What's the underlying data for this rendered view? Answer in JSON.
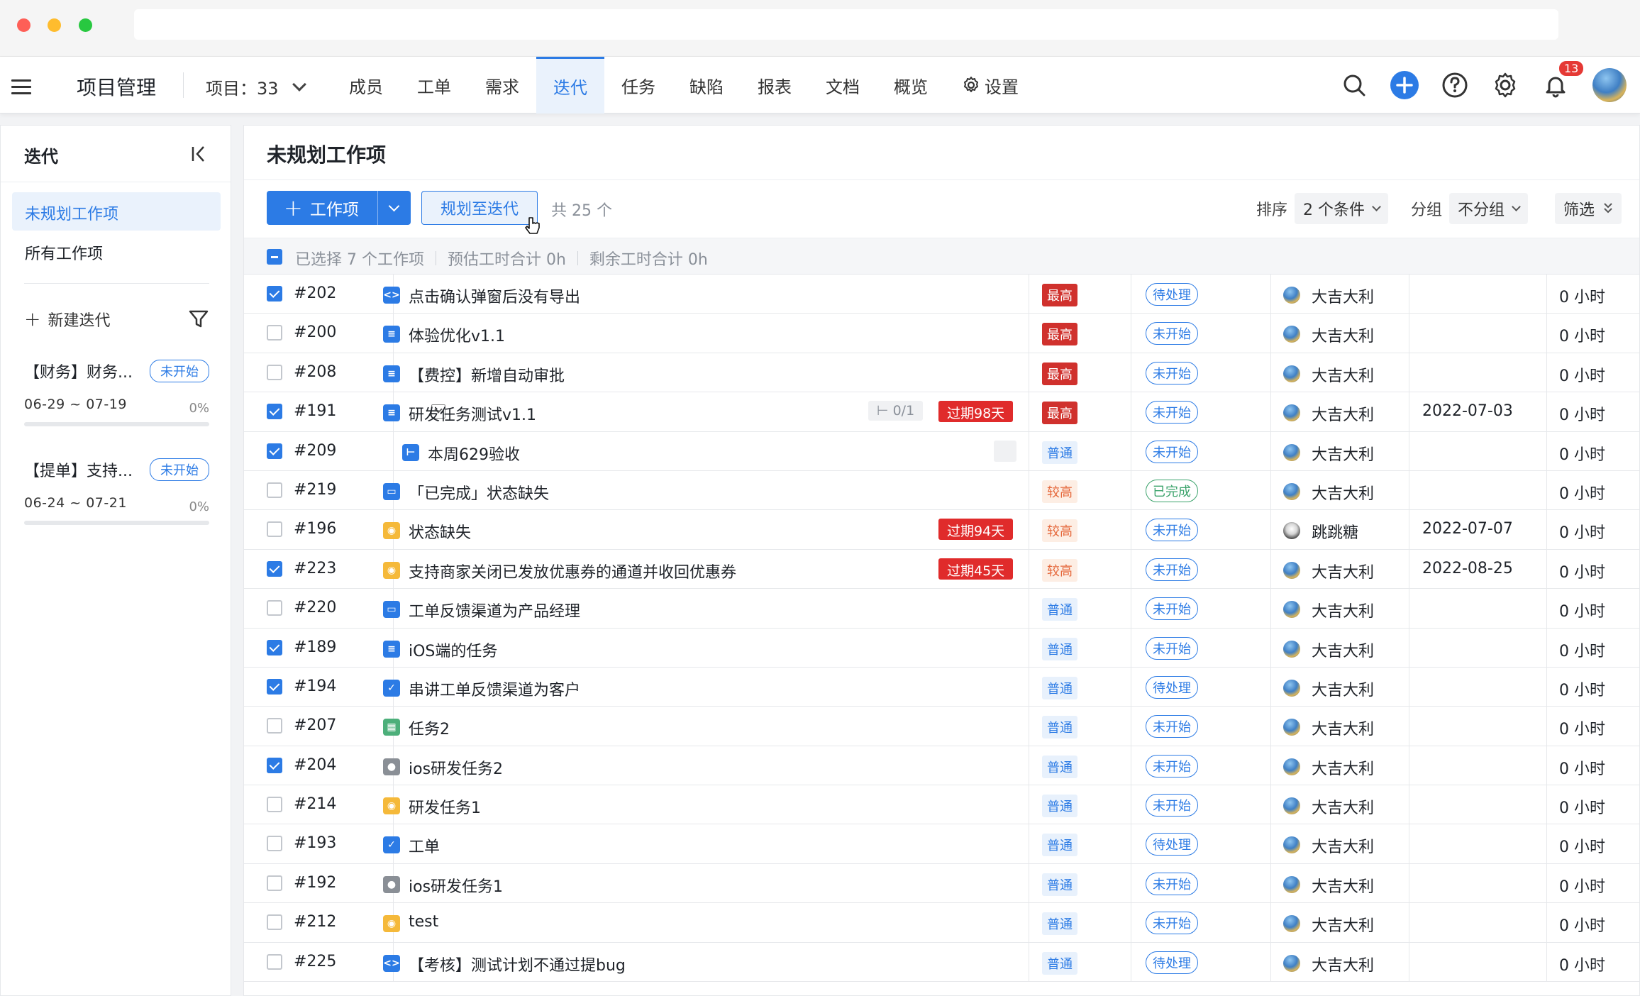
{
  "nav": {
    "app_title": "项目管理",
    "project_label": "项目：33",
    "tabs": [
      {
        "label": "成员",
        "active": false
      },
      {
        "label": "工单",
        "active": false
      },
      {
        "label": "需求",
        "active": false
      },
      {
        "label": "迭代",
        "active": true
      },
      {
        "label": "任务",
        "active": false
      },
      {
        "label": "缺陷",
        "active": false
      },
      {
        "label": "报表",
        "active": false
      },
      {
        "label": "文档",
        "active": false
      },
      {
        "label": "概览",
        "active": false
      },
      {
        "label": "设置",
        "active": false
      }
    ],
    "notification_count": "13",
    "accent": "#2c7be5"
  },
  "sidebar": {
    "title": "迭代",
    "items": [
      {
        "label": "未规划工作项",
        "active": true
      },
      {
        "label": "所有工作项",
        "active": false
      }
    ],
    "new_iteration": "新建迭代",
    "iterations": [
      {
        "name": "【财务】财务...",
        "status": "未开始",
        "dates": "06-29 ~ 07-19",
        "progress": "0%"
      },
      {
        "name": "【提单】支持...",
        "status": "未开始",
        "dates": "06-24 ~ 07-21",
        "progress": "0%"
      }
    ]
  },
  "main": {
    "title": "未规划工作项",
    "add_button": "工作项",
    "plan_button": "规划至迭代",
    "total": "共 25 个",
    "sort_label": "排序",
    "sort_value": "2 个条件",
    "group_label": "分组",
    "group_value": "不分组",
    "filter_label": "筛选",
    "selection": {
      "selected": "已选择 7 个工作项",
      "estimate": "预估工时合计 0h",
      "remaining": "剩余工时合计 0h"
    },
    "rows": [
      {
        "checked": true,
        "id": "#202",
        "icon": "code",
        "title": "点击确认弹窗后没有导出",
        "indent": 0,
        "priority": "最高",
        "ptype": "highest",
        "status": "待处理",
        "assignee": "大吉大利",
        "due": "",
        "hours": "0 小时"
      },
      {
        "checked": false,
        "id": "#200",
        "icon": "doc",
        "title": "体验优化v1.1",
        "indent": 0,
        "priority": "最高",
        "ptype": "highest",
        "status": "未开始",
        "assignee": "大吉大利",
        "due": "",
        "hours": "0 小时"
      },
      {
        "checked": false,
        "id": "#208",
        "icon": "doc",
        "title": "【费控】新增自动审批",
        "indent": 0,
        "priority": "最高",
        "ptype": "highest",
        "status": "未开始",
        "assignee": "大吉大利",
        "due": "",
        "hours": "0 小时"
      },
      {
        "checked": true,
        "id": "#191",
        "icon": "doc",
        "title": "研发任务测试v1.1",
        "indent": 0,
        "toggle": true,
        "subtasks": "0/1",
        "overdue": "过期98天",
        "priority": "最高",
        "ptype": "highest",
        "status": "未开始",
        "assignee": "大吉大利",
        "due": "2022-07-03",
        "hours": "0 小时"
      },
      {
        "checked": true,
        "id": "#209",
        "icon": "sub",
        "title": "本周629验收",
        "indent": 1,
        "subicon": true,
        "priority": "普通",
        "ptype": "normal",
        "status": "未开始",
        "assignee": "大吉大利",
        "due": "",
        "hours": "0 小时"
      },
      {
        "checked": false,
        "id": "#219",
        "icon": "monitor",
        "title": "「已完成」状态缺失",
        "indent": 0,
        "priority": "较高",
        "ptype": "high",
        "status": "已完成",
        "done": true,
        "assignee": "大吉大利",
        "due": "",
        "hours": "0 小时"
      },
      {
        "checked": false,
        "id": "#196",
        "icon": "bulb",
        "title": "状态缺失",
        "indent": 0,
        "overdue": "过期94天",
        "priority": "较高",
        "ptype": "high",
        "status": "未开始",
        "assignee": "跳跳糖",
        "altavatar": true,
        "due": "2022-07-07",
        "hours": "0 小时"
      },
      {
        "checked": true,
        "id": "#223",
        "icon": "bulb",
        "title": "支持商家关闭已发放优惠券的通道并收回优惠券",
        "indent": 0,
        "overdue": "过期45天",
        "priority": "较高",
        "ptype": "high",
        "status": "未开始",
        "assignee": "大吉大利",
        "due": "2022-08-25",
        "hours": "0 小时"
      },
      {
        "checked": false,
        "id": "#220",
        "icon": "monitor",
        "title": "工单反馈渠道为产品经理",
        "indent": 0,
        "priority": "普通",
        "ptype": "normal",
        "status": "未开始",
        "assignee": "大吉大利",
        "due": "",
        "hours": "0 小时"
      },
      {
        "checked": true,
        "id": "#189",
        "icon": "doc",
        "title": "iOS端的任务",
        "indent": 0,
        "priority": "普通",
        "ptype": "normal",
        "status": "未开始",
        "assignee": "大吉大利",
        "due": "",
        "hours": "0 小时"
      },
      {
        "checked": true,
        "id": "#194",
        "icon": "check",
        "title": "串讲工单反馈渠道为客户",
        "indent": 0,
        "priority": "普通",
        "ptype": "normal",
        "status": "待处理",
        "assignee": "大吉大利",
        "due": "",
        "hours": "0 小时"
      },
      {
        "checked": false,
        "id": "#207",
        "icon": "android",
        "title": "任务2",
        "indent": 0,
        "priority": "普通",
        "ptype": "normal",
        "status": "未开始",
        "assignee": "大吉大利",
        "due": "",
        "hours": "0 小时"
      },
      {
        "checked": true,
        "id": "#204",
        "icon": "apple",
        "title": "ios研发任务2",
        "indent": 0,
        "priority": "普通",
        "ptype": "normal",
        "status": "未开始",
        "assignee": "大吉大利",
        "due": "",
        "hours": "0 小时"
      },
      {
        "checked": false,
        "id": "#214",
        "icon": "bulb",
        "title": "研发任务1",
        "indent": 0,
        "priority": "普通",
        "ptype": "normal",
        "status": "未开始",
        "assignee": "大吉大利",
        "due": "",
        "hours": "0 小时"
      },
      {
        "checked": false,
        "id": "#193",
        "icon": "check",
        "title": "工单",
        "indent": 0,
        "priority": "普通",
        "ptype": "normal",
        "status": "待处理",
        "assignee": "大吉大利",
        "due": "",
        "hours": "0 小时"
      },
      {
        "checked": false,
        "id": "#192",
        "icon": "apple",
        "title": "ios研发任务1",
        "indent": 0,
        "priority": "普通",
        "ptype": "normal",
        "status": "未开始",
        "assignee": "大吉大利",
        "due": "",
        "hours": "0 小时"
      },
      {
        "checked": false,
        "id": "#212",
        "icon": "bulb",
        "title": "test",
        "indent": 0,
        "priority": "普通",
        "ptype": "normal",
        "status": "未开始",
        "assignee": "大吉大利",
        "due": "",
        "hours": "0 小时"
      },
      {
        "checked": false,
        "id": "#225",
        "icon": "code",
        "title": "【考核】测试计划不通过提bug",
        "indent": 0,
        "priority": "普通",
        "ptype": "normal",
        "status": "待处理",
        "assignee": "大吉大利",
        "due": "",
        "hours": "0 小时"
      }
    ]
  }
}
